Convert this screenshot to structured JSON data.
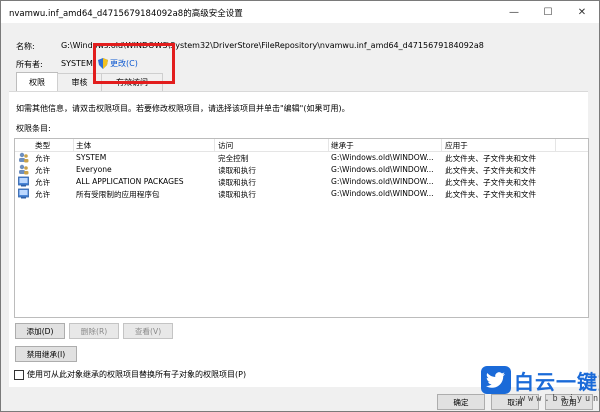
{
  "window": {
    "title": "nvamwu.inf_amd64_d4715679184092a8的高级安全设置",
    "minimize_glyph": "—",
    "maximize_glyph": "☐",
    "close_glyph": "✕"
  },
  "info": {
    "name_label": "名称:",
    "name_value": "G:\\Windows.old\\WINDOWS\\System32\\DriverStore\\FileRepository\\nvamwu.inf_amd64_d4715679184092a8",
    "owner_label": "所有者:",
    "owner_value": "SYSTEM",
    "change_link": "更改(C)"
  },
  "tabs": [
    {
      "label": "权限",
      "active": true
    },
    {
      "label": "审核",
      "active": false
    },
    {
      "label": "有效访问",
      "active": false
    }
  ],
  "hint": "如需其他信息，请双击权限项目。若要修改权限项目，请选择该项目并单击\"编辑\"(如果可用)。",
  "entries_label": "权限条目:",
  "table": {
    "headers": [
      "类型",
      "主体",
      "访问",
      "继承于",
      "应用于"
    ],
    "rows": [
      {
        "icon": "user-group-icon",
        "type": "允许",
        "principal": "SYSTEM",
        "access": "完全控制",
        "inherited": "G:\\Windows.old\\WINDOW...",
        "applies": "此文件夹、子文件夹和文件"
      },
      {
        "icon": "user-group-icon",
        "type": "允许",
        "principal": "Everyone",
        "access": "读取和执行",
        "inherited": "G:\\Windows.old\\WINDOW...",
        "applies": "此文件夹、子文件夹和文件"
      },
      {
        "icon": "app-package-icon",
        "type": "允许",
        "principal": "ALL APPLICATION PACKAGES",
        "access": "读取和执行",
        "inherited": "G:\\Windows.old\\WINDOW...",
        "applies": "此文件夹、子文件夹和文件"
      },
      {
        "icon": "app-package-icon",
        "type": "允许",
        "principal": "所有受限制的应用程序包",
        "access": "读取和执行",
        "inherited": "G:\\Windows.old\\WINDOW...",
        "applies": "此文件夹、子文件夹和文件"
      }
    ]
  },
  "buttons": {
    "add": "添加(D)",
    "remove": "删除(R)",
    "view": "查看(V)",
    "disable_inheritance": "禁用继承(I)"
  },
  "replace_checkbox": {
    "checked": false,
    "label": "使用可从此对象继承的权限项目替换所有子对象的权限项目(P)"
  },
  "footer": {
    "ok": "确定",
    "cancel": "取消",
    "apply": "应用"
  },
  "watermark": {
    "name": "白云一键重装系统",
    "url": "www.baiyunxitong.com"
  },
  "colors": {
    "highlight_box": "#e21d1d",
    "brand": "#1a6ad8"
  }
}
